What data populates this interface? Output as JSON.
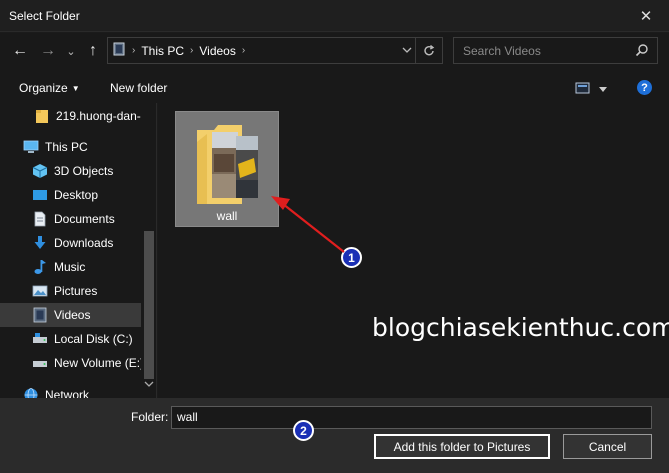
{
  "window": {
    "title": "Select Folder",
    "close_glyph": "✕"
  },
  "nav_buttons": {
    "back": "←",
    "forward": "→",
    "recent": "⌄",
    "up": "↑"
  },
  "address": {
    "crumbs": [
      "This PC",
      "Videos"
    ],
    "separator": "›"
  },
  "search": {
    "placeholder": "Search Videos"
  },
  "commands": {
    "organize": "Organize",
    "new_folder": "New folder",
    "help": "?"
  },
  "sidebar": {
    "items": [
      {
        "label": "219.huong-dan-",
        "icon": "folder-icon"
      },
      {
        "label": "This PC",
        "icon": "this-pc-icon"
      },
      {
        "label": "3D Objects",
        "icon": "3d-objects-icon"
      },
      {
        "label": "Desktop",
        "icon": "desktop-icon"
      },
      {
        "label": "Documents",
        "icon": "documents-icon"
      },
      {
        "label": "Downloads",
        "icon": "downloads-icon"
      },
      {
        "label": "Music",
        "icon": "music-icon"
      },
      {
        "label": "Pictures",
        "icon": "pictures-icon"
      },
      {
        "label": "Videos",
        "icon": "videos-icon",
        "selected": true
      },
      {
        "label": "Local Disk (C:)",
        "icon": "local-disk-icon"
      },
      {
        "label": "New Volume (E:)",
        "icon": "drive-icon"
      },
      {
        "label": "Network",
        "icon": "network-icon"
      }
    ]
  },
  "content": {
    "folders": [
      {
        "name": "wall"
      }
    ],
    "watermark": "blogchiasekienthuc.com",
    "annotations": [
      "1",
      "2"
    ]
  },
  "footer": {
    "folder_label": "Folder:",
    "folder_value": "wall",
    "primary_button": "Add this folder to Pictures",
    "cancel_button": "Cancel"
  },
  "colors": {
    "background": "#191919",
    "tile": "#777777",
    "annotation_arrow": "#e01e1e",
    "badge": "#1a2fb5",
    "help": "#1e6fd8"
  }
}
